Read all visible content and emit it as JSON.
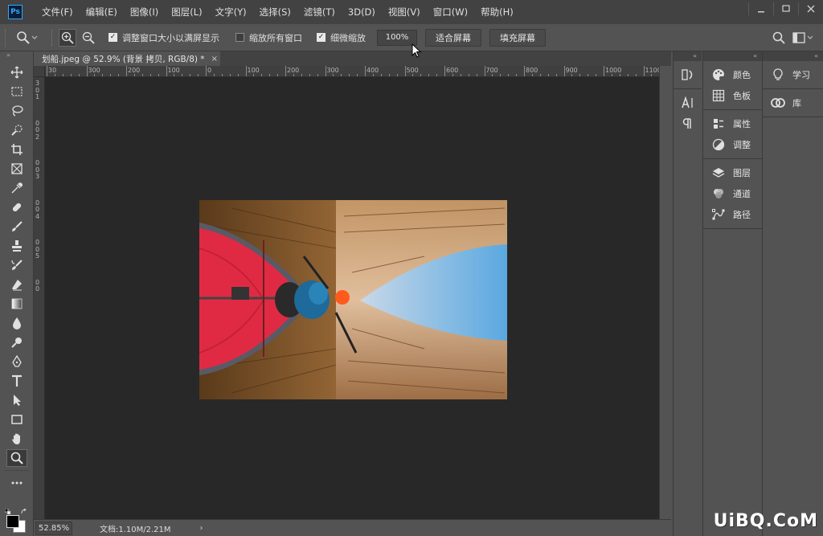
{
  "menubar": {
    "items": [
      "文件(F)",
      "编辑(E)",
      "图像(I)",
      "图层(L)",
      "文字(Y)",
      "选择(S)",
      "滤镜(T)",
      "3D(D)",
      "视图(V)",
      "窗口(W)",
      "帮助(H)"
    ],
    "logo": "Ps"
  },
  "options": {
    "resize_windows_label": "调整窗口大小以满屏显示",
    "resize_windows_checked": true,
    "zoom_all_label": "缩放所有窗口",
    "zoom_all_checked": false,
    "scrubby_label": "细微缩放",
    "scrubby_checked": true,
    "zoom_value": "100%",
    "fit_screen_label": "适合屏幕",
    "fill_screen_label": "填充屏幕"
  },
  "document": {
    "tab_title": "划船.jpeg @ 52.9% (背景 拷贝, RGB/8) *",
    "close": "×"
  },
  "ruler": {
    "h_labels": [
      "30",
      "300",
      "200",
      "100",
      "0",
      "100",
      "200",
      "300",
      "400",
      "500",
      "600",
      "700",
      "800",
      "900",
      "1000",
      "1100"
    ],
    "v_labels": [
      "3",
      "0",
      "1",
      "0",
      "0",
      "2",
      "0",
      "0",
      "3",
      "0",
      "0",
      "4",
      "0",
      "0",
      "5",
      "0",
      "0"
    ]
  },
  "status": {
    "zoom": "52.85%",
    "doc_info": "文档:1.10M/2.21M",
    "arrow": "›"
  },
  "panels": {
    "col1": [
      {
        "group": [
          {
            "label": "颜色",
            "icon": "palette-icon"
          },
          {
            "label": "色板",
            "icon": "swatches-grid-icon"
          }
        ]
      },
      {
        "group": [
          {
            "label": "属性",
            "icon": "properties-icon"
          },
          {
            "label": "调整",
            "icon": "adjustments-icon"
          }
        ]
      },
      {
        "group": [
          {
            "label": "图层",
            "icon": "layers-icon"
          },
          {
            "label": "通道",
            "icon": "channels-icon"
          },
          {
            "label": "路径",
            "icon": "paths-icon"
          }
        ]
      }
    ],
    "col2": [
      {
        "label": "学习",
        "icon": "lightbulb-icon"
      },
      {
        "label": "库",
        "icon": "cc-libraries-icon"
      }
    ]
  },
  "watermark": "UiBQ.CoM",
  "colors": {
    "bg": "#535353",
    "menubar": "#424242",
    "canvas": "#282828",
    "accent": "#31a8ff"
  }
}
